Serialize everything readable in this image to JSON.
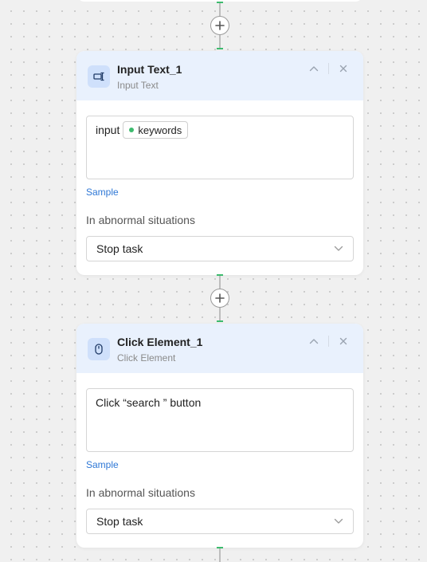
{
  "nodes": [
    {
      "title": "Input Text_1",
      "subtitle": "Input Text",
      "icon": "input-text-icon",
      "content_prefix": "input",
      "variable": "keywords",
      "sample_label": "Sample",
      "abnormal_label": "In abnormal situations",
      "abnormal_value": "Stop task"
    },
    {
      "title": "Click Element_1",
      "subtitle": "Click Element",
      "icon": "mouse-icon",
      "content_text": "Click “search ” button",
      "sample_label": "Sample",
      "abnormal_label": "In abnormal situations",
      "abnormal_value": "Stop task"
    }
  ],
  "colors": {
    "accent_green": "#3dbb6e",
    "header_bg": "#e9f1fd",
    "link_blue": "#2f78d6"
  }
}
